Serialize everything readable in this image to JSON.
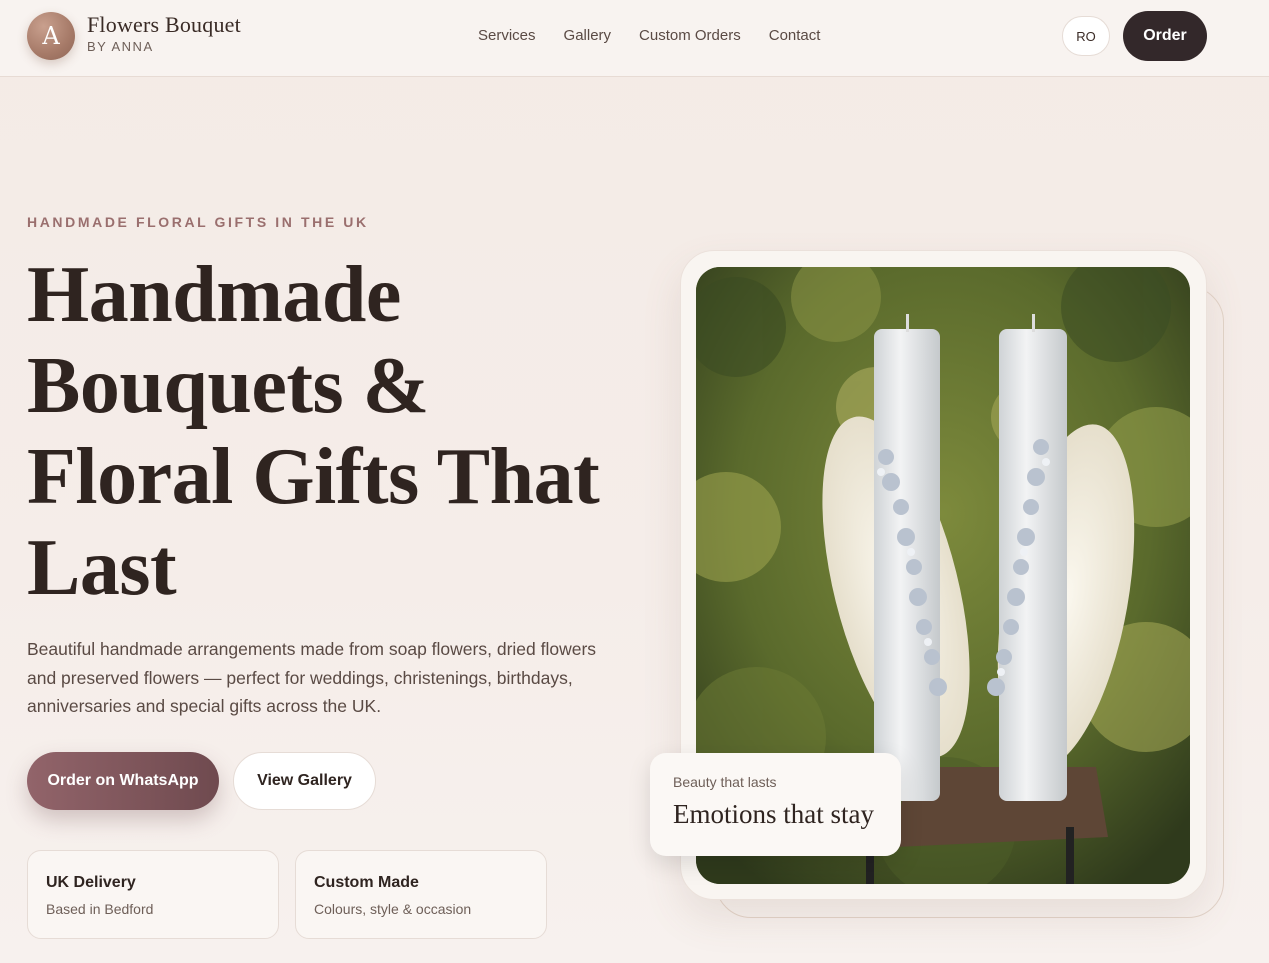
{
  "brand": {
    "initial": "A",
    "name": "Flowers Bouquet",
    "subtitle": "BY ANNA"
  },
  "nav": {
    "items": [
      {
        "label": "Services"
      },
      {
        "label": "Gallery"
      },
      {
        "label": "Custom Orders"
      },
      {
        "label": "Contact"
      }
    ]
  },
  "header": {
    "lang_label": "RO",
    "order_label": "Order"
  },
  "hero": {
    "eyebrow": "HANDMADE FLORAL GIFTS IN THE UK",
    "title_lines": [
      "Handmade",
      "Bouquets &",
      "Floral Gifts That",
      "Last"
    ],
    "lead": "Beautiful handmade arrangements made from soap flowers, dried flowers and preserved flowers — perfect for weddings, christenings, birthdays, anniversaries and special gifts across the UK.",
    "primary_btn": "Order on WhatsApp",
    "secondary_btn": "View Gallery"
  },
  "features": [
    {
      "title": "UK Delivery",
      "subtitle": "Based in Bedford"
    },
    {
      "title": "Custom Made",
      "subtitle": "Colours, style & occasion"
    }
  ],
  "caption": {
    "small": "Beauty that lasts",
    "big": "Emotions that stay"
  },
  "colors": {
    "accent": "#7d5459",
    "dark": "#33282a",
    "background": "#f4ebe6"
  }
}
